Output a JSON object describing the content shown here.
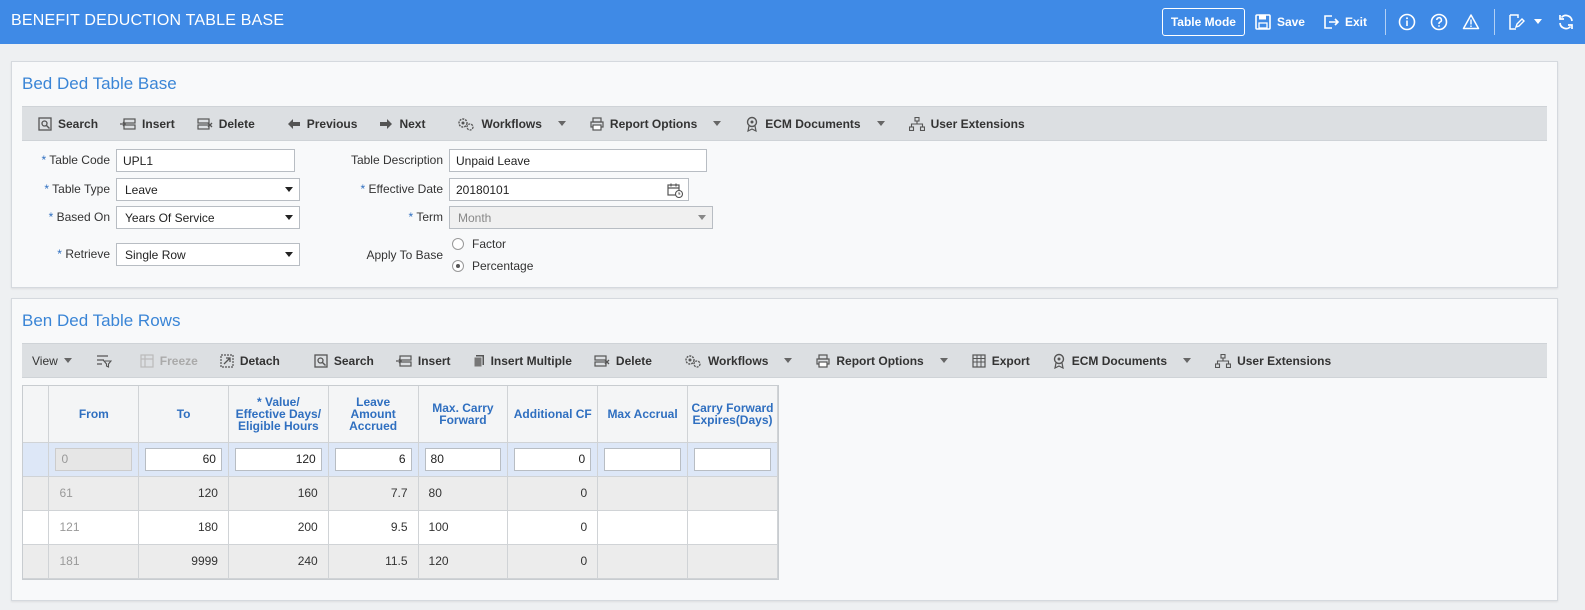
{
  "app": {
    "title": "BENEFIT DEDUCTION TABLE BASE",
    "table_mode": "Table Mode",
    "save": "Save",
    "exit": "Exit"
  },
  "header": {
    "title": "Bed Ded Table Base",
    "toolbar": {
      "search": "Search",
      "insert": "Insert",
      "delete": "Delete",
      "previous": "Previous",
      "next": "Next",
      "workflows": "Workflows",
      "report_options": "Report Options",
      "ecm_documents": "ECM Documents",
      "user_extensions": "User Extensions"
    },
    "fields": {
      "table_code_label": "Table Code",
      "table_code": "UPL1",
      "table_type_label": "Table Type",
      "table_type": "Leave",
      "based_on_label": "Based On",
      "based_on": "Years Of Service",
      "retrieve_label": "Retrieve",
      "retrieve": "Single Row",
      "table_description_label": "Table Description",
      "table_description": "Unpaid Leave",
      "effective_date_label": "Effective Date",
      "effective_date": "20180101",
      "term_label": "Term",
      "term": "Month",
      "apply_to_base_label": "Apply To Base",
      "apply_options": [
        "Factor",
        "Percentage"
      ],
      "apply_selected": "Percentage"
    },
    "required_marker": "*"
  },
  "rows_panel": {
    "title": "Ben Ded Table Rows",
    "toolbar": {
      "view": "View",
      "freeze": "Freeze",
      "detach": "Detach",
      "search": "Search",
      "insert": "Insert",
      "insert_multiple": "Insert Multiple",
      "delete": "Delete",
      "workflows": "Workflows",
      "report_options": "Report Options",
      "export": "Export",
      "ecm_documents": "ECM Documents",
      "user_extensions": "User Extensions"
    },
    "columns": {
      "from": "From",
      "to": "To",
      "value_1": "* Value/",
      "value_2": "Effective Days/",
      "value_3": "Eligible Hours",
      "leave_1": "Leave",
      "leave_2": "Amount",
      "leave_3": "Accrued",
      "maxcf_1": "Max. Carry",
      "maxcf_2": "Forward",
      "additional_cf": "Additional CF",
      "max_accrual": "Max Accrual",
      "cfe_1": "Carry Forward",
      "cfe_2": "Expires(Days)"
    },
    "edit_row": {
      "from": "0",
      "to": "60",
      "value": "120",
      "leave": "6",
      "max_cf": "80",
      "additional_cf": "0",
      "max_accrual": "",
      "cf_expires": ""
    },
    "rows": [
      {
        "from": "61",
        "to": "120",
        "value": "160",
        "leave": "7.7",
        "max_cf": "80",
        "additional_cf": "0"
      },
      {
        "from": "121",
        "to": "180",
        "value": "200",
        "leave": "9.5",
        "max_cf": "100",
        "additional_cf": "0"
      },
      {
        "from": "181",
        "to": "9999",
        "value": "240",
        "leave": "11.5",
        "max_cf": "120",
        "additional_cf": "0"
      }
    ]
  }
}
